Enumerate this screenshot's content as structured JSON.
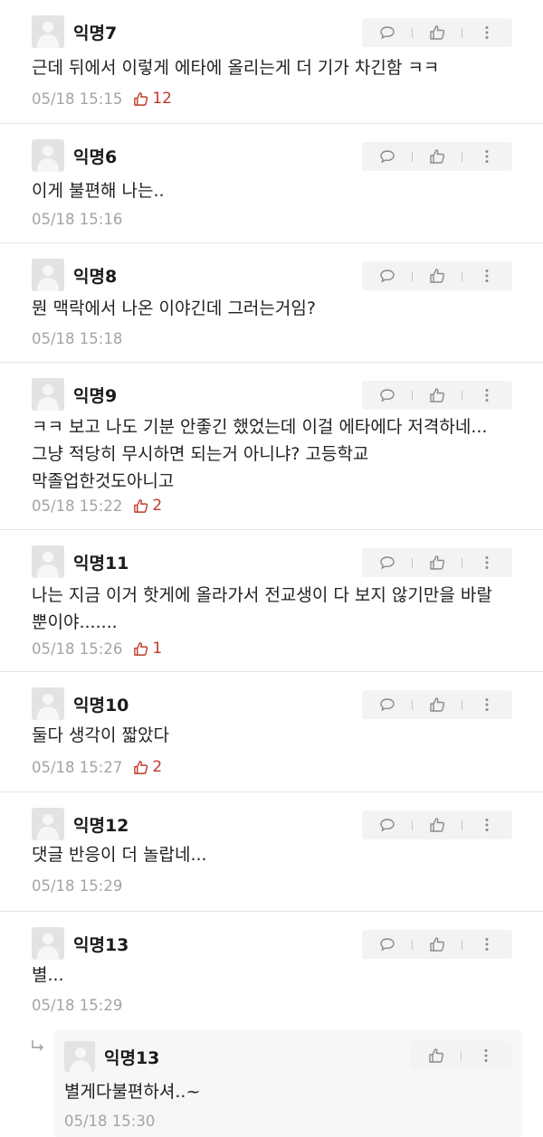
{
  "comments": [
    {
      "author": "익명7",
      "text": "근데 뒤에서 이렇게 에타에 올리는게 더 기가 차긴함 ㅋㅋ",
      "time": "05/18 15:15",
      "likes": "12"
    },
    {
      "author": "익명6",
      "text": "이게 불편해 나는..",
      "time": "05/18 15:16",
      "likes": ""
    },
    {
      "author": "익명8",
      "text": "뭔 맥락에서 나온 이야긴데 그러는거임?",
      "time": "05/18 15:18",
      "likes": ""
    },
    {
      "author": "익명9",
      "text": "ㅋㅋ 보고 나도 기분 안좋긴 했었는데 이걸 에타에다 저격하네... 그냥 적당히 무시하면 되는거 아니냐? 고등학교 막졸업한것도아니고",
      "time": "05/18 15:22",
      "likes": "2"
    },
    {
      "author": "익명11",
      "text": "나는 지금 이거 핫게에 올라가서 전교생이 다 보지 않기만을 바랄 뿐이야.......",
      "time": "05/18 15:26",
      "likes": "1"
    },
    {
      "author": "익명10",
      "text": "둘다 생각이 짧았다",
      "time": "05/18 15:27",
      "likes": "2"
    },
    {
      "author": "익명12",
      "text": "댓글 반응이 더 놀랍네...",
      "time": "05/18 15:29",
      "likes": ""
    },
    {
      "author": "익명13",
      "text": "별...",
      "time": "05/18 15:29",
      "likes": ""
    }
  ],
  "reply": {
    "author": "익명13",
    "text": "별게다불편하셔..~",
    "time": "05/18 15:30"
  },
  "icons": {
    "reply": "speech-bubble-icon",
    "like": "thumbs-up-icon",
    "more": "vertical-dots-icon",
    "reply_arrow": "reply-arrow-icon",
    "avatar": "default-avatar-icon"
  },
  "colors": {
    "like_count": "#c0392b",
    "meta": "#a4a4a4",
    "action_bg": "#f3f3f3",
    "reply_bg": "#f7f7f7"
  }
}
